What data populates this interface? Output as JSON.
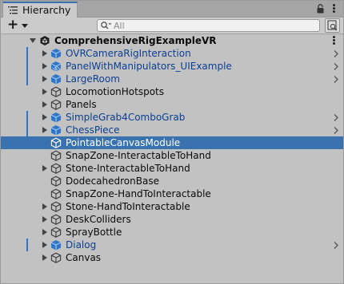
{
  "window": {
    "tab_label": "Hierarchy"
  },
  "toolbar": {
    "add_label": "+",
    "search_placeholder": "All"
  },
  "hierarchy": {
    "scene_label": "ComprehensiveRigExampleVR",
    "items": [
      {
        "label": "OVRCameraRigInteraction",
        "kind": "prefab",
        "expandable": true,
        "changed": true,
        "overflow_arrow": true
      },
      {
        "label": "PanelWithManipulators_UIExample",
        "kind": "prefab-variant",
        "expandable": true,
        "changed": true,
        "overflow_arrow": true
      },
      {
        "label": "LargeRoom",
        "kind": "prefab",
        "expandable": true,
        "changed": true,
        "overflow_arrow": true
      },
      {
        "label": "LocomotionHotspots",
        "kind": "gameobject",
        "expandable": true,
        "changed": false,
        "overflow_arrow": false
      },
      {
        "label": "Panels",
        "kind": "gameobject",
        "expandable": true,
        "changed": false,
        "overflow_arrow": false
      },
      {
        "label": "SimpleGrab4ComboGrab",
        "kind": "prefab",
        "expandable": true,
        "changed": true,
        "overflow_arrow": true
      },
      {
        "label": "ChessPiece",
        "kind": "prefab",
        "expandable": true,
        "changed": true,
        "overflow_arrow": true
      },
      {
        "label": "PointableCanvasModule",
        "kind": "gameobject",
        "expandable": false,
        "changed": false,
        "overflow_arrow": false,
        "selected": true
      },
      {
        "label": "SnapZone-InteractableToHand",
        "kind": "gameobject",
        "expandable": false,
        "changed": false,
        "overflow_arrow": false
      },
      {
        "label": "Stone-InteractableToHand",
        "kind": "gameobject",
        "expandable": true,
        "changed": false,
        "overflow_arrow": false
      },
      {
        "label": "DodecahedronBase",
        "kind": "gameobject",
        "expandable": false,
        "changed": false,
        "overflow_arrow": false
      },
      {
        "label": "SnapZone-HandToInteractable",
        "kind": "gameobject",
        "expandable": false,
        "changed": false,
        "overflow_arrow": false
      },
      {
        "label": "Stone-HandToInteractable",
        "kind": "gameobject",
        "expandable": true,
        "changed": false,
        "overflow_arrow": false
      },
      {
        "label": "DeskColliders",
        "kind": "gameobject",
        "expandable": true,
        "changed": false,
        "overflow_arrow": false
      },
      {
        "label": "SprayBottle",
        "kind": "gameobject",
        "expandable": true,
        "changed": false,
        "overflow_arrow": false
      },
      {
        "label": "Dialog",
        "kind": "prefab",
        "expandable": true,
        "changed": true,
        "overflow_arrow": true
      },
      {
        "label": "Canvas",
        "kind": "gameobject",
        "expandable": true,
        "changed": false,
        "overflow_arrow": false
      }
    ]
  },
  "colors": {
    "selection": "#3a72b0",
    "prefab_text": "#0c3f90",
    "prefab_icon": "#2f76c8",
    "change_marker": "#2f76c8"
  }
}
